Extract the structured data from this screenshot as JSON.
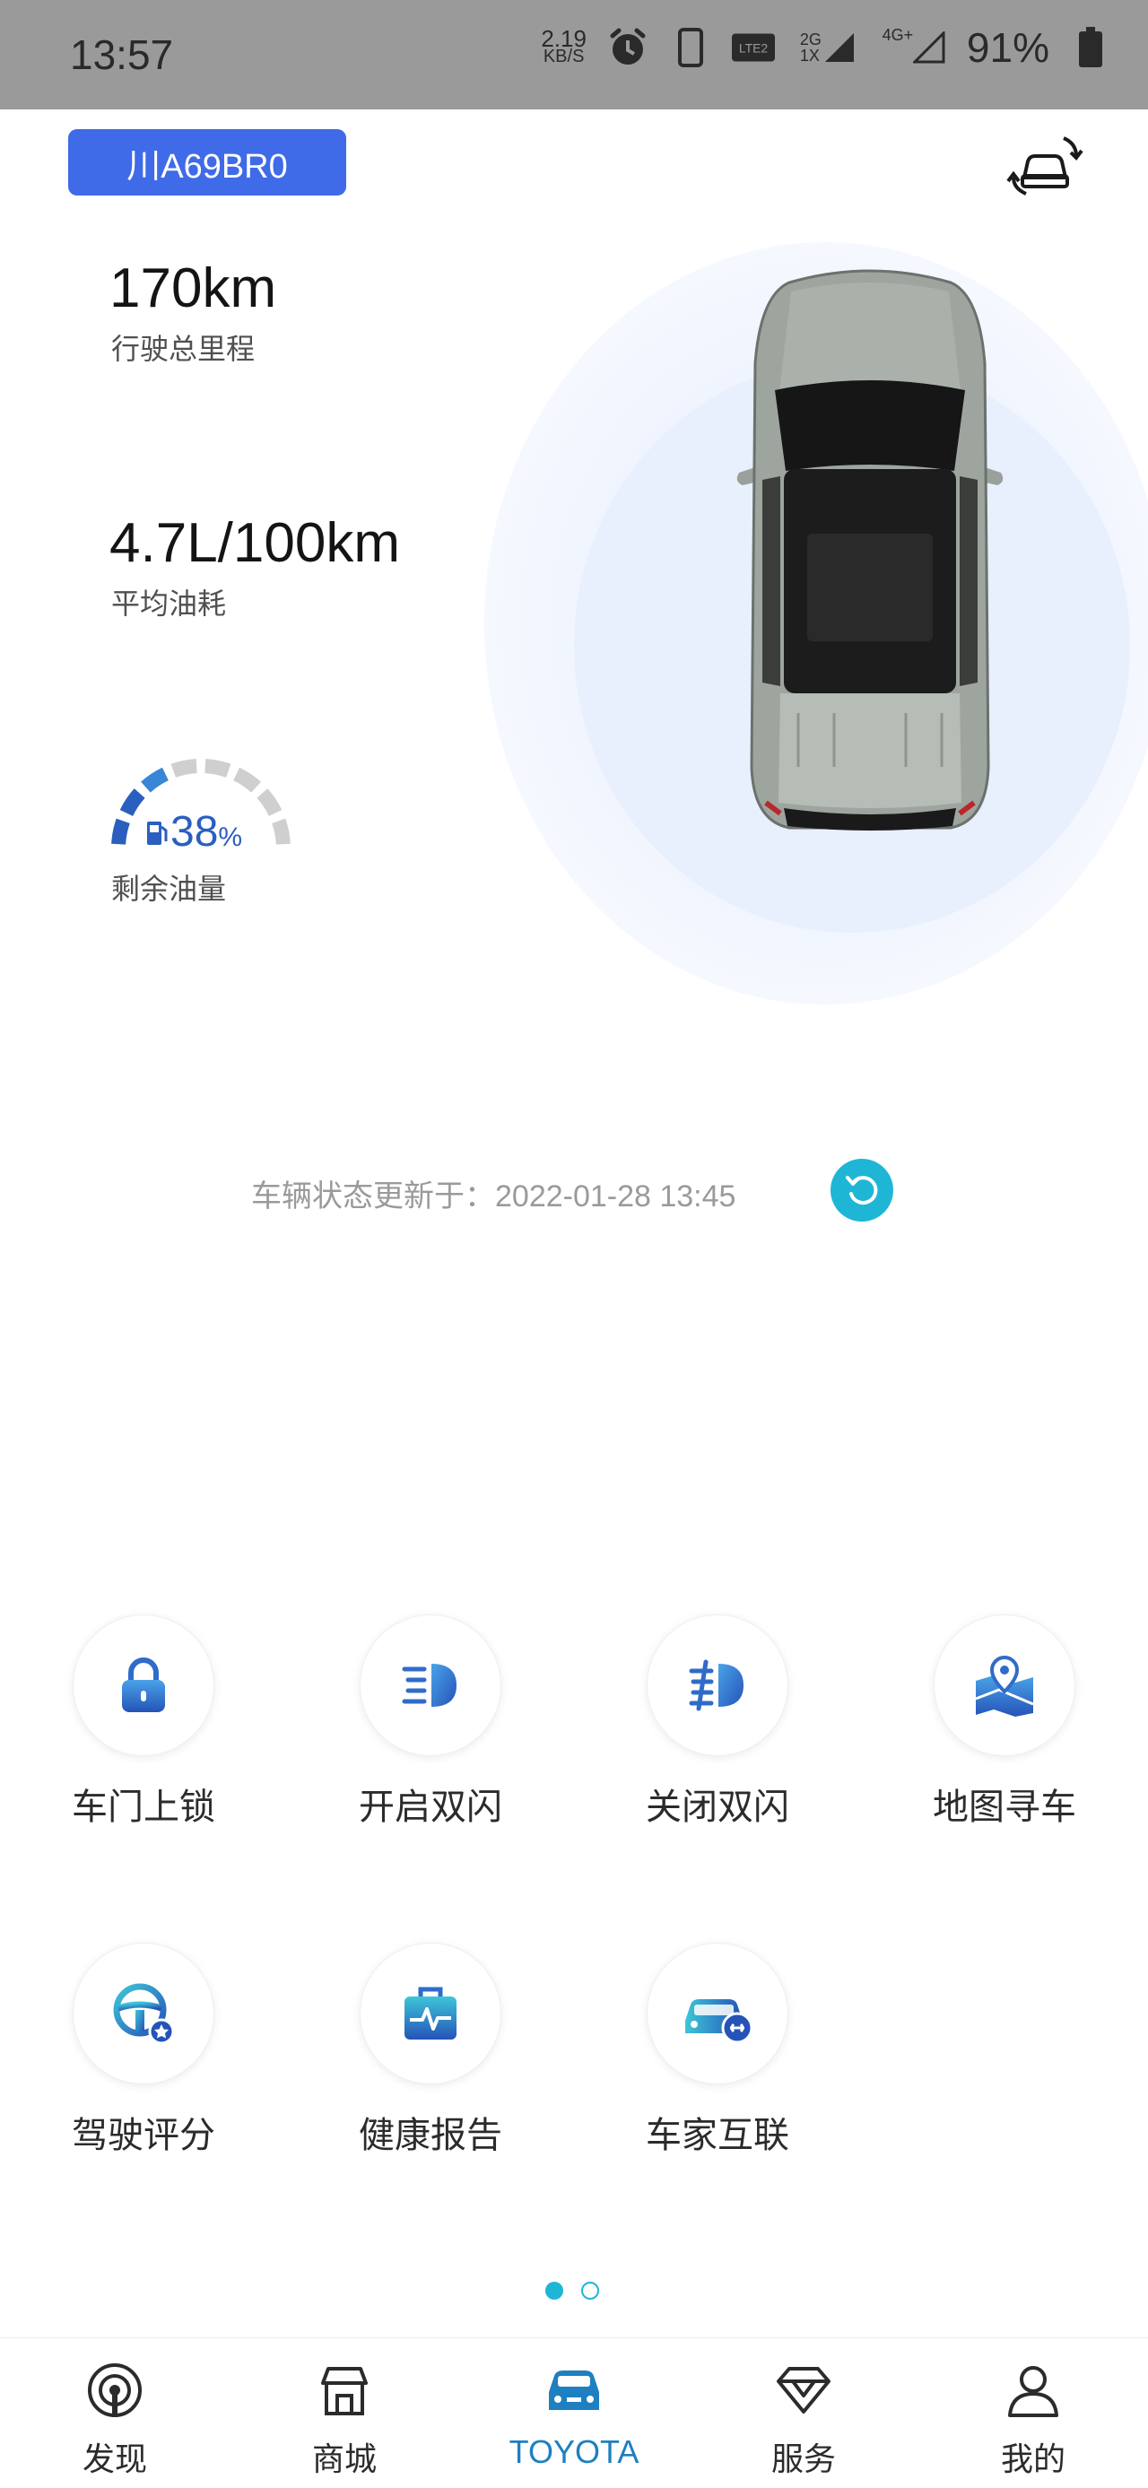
{
  "status_bar": {
    "time": "13:57",
    "net_speed_value": "2.19",
    "net_speed_unit": "KB/S",
    "network_1": "2G",
    "network_2": "1X",
    "network_3": "4G+",
    "battery": "91%"
  },
  "vehicle": {
    "plate": "川A69BR0",
    "mileage_value": "170km",
    "mileage_label": "行驶总里程",
    "fuel_consumption_value": "4.7L/100km",
    "fuel_consumption_label": "平均油耗",
    "fuel_level_value": "38",
    "fuel_level_unit": "%",
    "fuel_level_fraction": 0.38,
    "fuel_level_label": "剩余油量"
  },
  "update": {
    "text": "车辆状态更新于：2022-01-28 13:45"
  },
  "functions": [
    {
      "label": "车门上锁",
      "icon": "lock-icon"
    },
    {
      "label": "开启双闪",
      "icon": "hazard-on-icon"
    },
    {
      "label": "关闭双闪",
      "icon": "hazard-off-icon"
    },
    {
      "label": "地图寻车",
      "icon": "map-pin-icon"
    },
    {
      "label": "驾驶评分",
      "icon": "steering-wheel-icon"
    },
    {
      "label": "健康报告",
      "icon": "health-report-icon"
    },
    {
      "label": "车家互联",
      "icon": "car-link-icon"
    }
  ],
  "pager": {
    "active": 1,
    "total": 2
  },
  "nav": [
    {
      "label": "发现",
      "icon": "discover-icon"
    },
    {
      "label": "商城",
      "icon": "store-icon"
    },
    {
      "label": "TOYOTA",
      "icon": "car-icon"
    },
    {
      "label": "服务",
      "icon": "diamond-icon"
    },
    {
      "label": "我的",
      "icon": "profile-icon"
    }
  ],
  "colors": {
    "accent": "#1fb6d6",
    "plate": "#3f6ae8",
    "nav_active": "#1e7fc1",
    "icon_blue": "#2c6cc8"
  }
}
